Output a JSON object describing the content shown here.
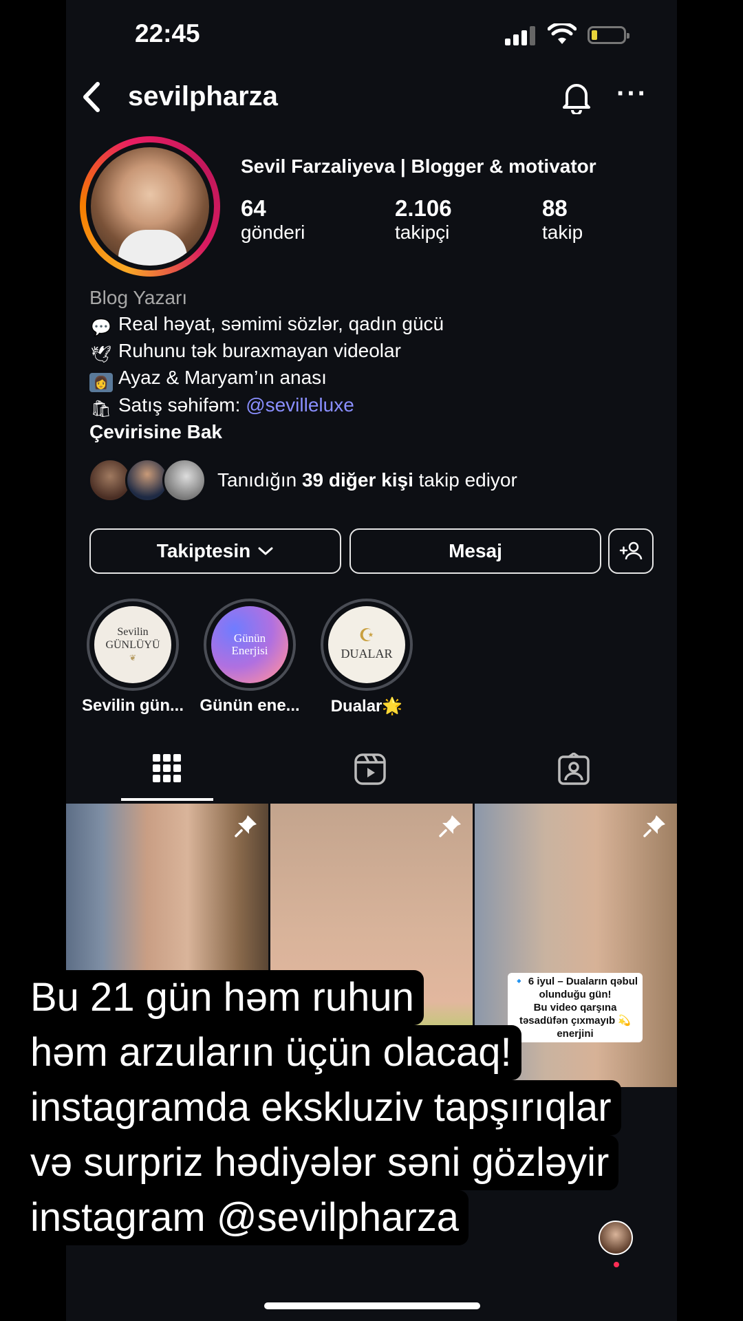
{
  "status_bar": {
    "time": "22:45"
  },
  "header": {
    "username": "sevilpharza"
  },
  "profile": {
    "full_name": "Sevil Farzaliyeva | Blogger & motivator",
    "stats": [
      {
        "value": "64",
        "label": "gönderi"
      },
      {
        "value": "2.106",
        "label": "takipçi"
      },
      {
        "value": "88",
        "label": "takip"
      }
    ],
    "category": "Blog Yazarı",
    "bio_lines": [
      {
        "icon": "speech-bubble-icon",
        "text": "Real həyat, səmimi sözlər, qadın gücü"
      },
      {
        "icon": "dove-icon",
        "text": "Ruhunu tək buraxmayan videolar"
      },
      {
        "icon": "mother-child-icon",
        "text": "Ayaz & Maryam’ın anası"
      },
      {
        "icon": "shopping-bags-icon",
        "text": "Satış səhifəm: ",
        "link": "@sevilleluxe"
      }
    ],
    "translate": "Çevirisine Bak",
    "mutual": {
      "prefix": "Tanıdığın ",
      "bold": "39 diğer kişi",
      "suffix": " takip ediyor"
    }
  },
  "buttons": {
    "following": "Takiptesin",
    "message": "Mesaj"
  },
  "highlights": [
    {
      "label": "Sevilin gün...",
      "cover_line1": "Sevilin",
      "cover_line2": "GÜNLÜYÜ"
    },
    {
      "label": "Günün ene...",
      "cover_line1": "Günün",
      "cover_line2": "Enerjisi"
    },
    {
      "label": "Dualar🌟",
      "cover_line1": "☪",
      "cover_line2": "DUALAR"
    }
  ],
  "tabs": [
    "grid-icon",
    "reels-icon",
    "tagged-icon"
  ],
  "posts": [
    {
      "pinned": true
    },
    {
      "pinned": true
    },
    {
      "pinned": true,
      "sticker_lines": [
        "🔹 6 iyul – Duaların qəbul",
        "olunduğu gün!",
        "Bu video qarşına",
        "təsadüfən çıxmayıb 💫",
        "enerjini"
      ]
    }
  ],
  "caption_overlay": [
    "Bu 21 gün həm ruhun",
    "həm arzuların üçün olacaq!",
    "instagramda ekskluziv tapşırıqlar",
    "və surpriz hədiyələr səni gözləyir",
    "instagram @sevilpharza"
  ],
  "colors": {
    "background": "#0d0f14",
    "link": "#8a8fff",
    "ring_start": "#f9a825",
    "ring_end": "#e91e63"
  }
}
